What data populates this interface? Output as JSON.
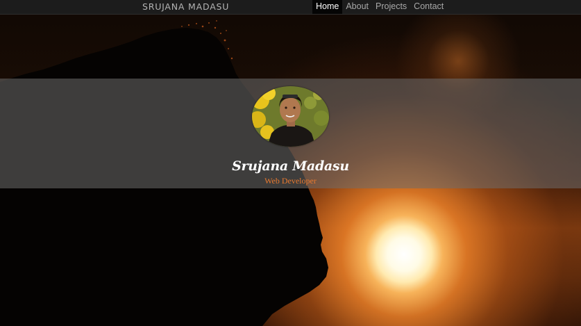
{
  "navbar": {
    "brand": "SRUJANA MADASU",
    "items": [
      {
        "label": "Home",
        "active": true
      },
      {
        "label": "About",
        "active": false
      },
      {
        "label": "Projects",
        "active": false
      },
      {
        "label": "Contact",
        "active": false
      }
    ]
  },
  "profile": {
    "name": "Srujana Madasu",
    "role": "Web Developer"
  },
  "colors": {
    "nav_bg": "#1c1c1c",
    "accent": "#e8792f",
    "active_tab_bg": "#050505"
  }
}
